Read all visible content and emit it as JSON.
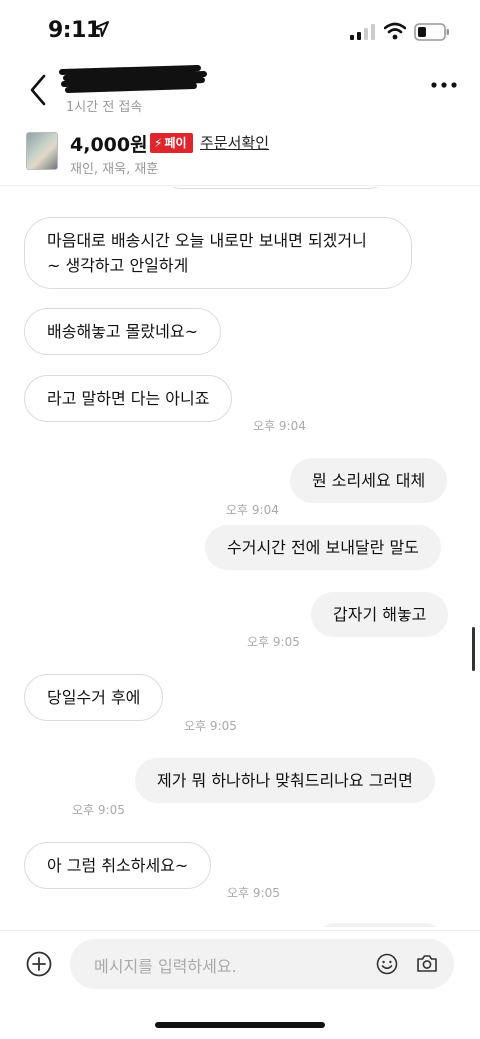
{
  "status_bar": {
    "time": "9:11"
  },
  "header": {
    "last_seen": "1시간 전 접속"
  },
  "product": {
    "price": "4,000원",
    "pay_badge": "페이",
    "order_link": "주문서확인",
    "tags": "재인, 재욱, 재훈"
  },
  "messages": [
    {
      "side": "in",
      "text": "마음대로 배송시간 오늘 내로만 보내면 되겠거니\n~ 생각하고 안일하게"
    },
    {
      "side": "in",
      "text": "배송해놓고 몰랐네요~"
    },
    {
      "side": "in",
      "text": "라고 말하면 다는 아니죠",
      "time": "오후 9:04"
    },
    {
      "side": "out",
      "text": "뭔 소리세요 대체",
      "time": "오후 9:04"
    },
    {
      "side": "out",
      "text": "수거시간 전에 보내달란 말도"
    },
    {
      "side": "out",
      "text": "갑자기 해놓고",
      "time": "오후 9:05"
    },
    {
      "side": "in",
      "text": "당일수거 후에",
      "time": "오후 9:05"
    },
    {
      "side": "out",
      "text": "제가 뭐 하나하나 맞춰드리나요 그러면",
      "time": "오후 9:05"
    },
    {
      "side": "in",
      "text": "아 그럼 취소하세요~",
      "time": "오후 9:05"
    }
  ],
  "input": {
    "placeholder": "메시지를 입력하세요."
  },
  "icons": {
    "back": "chevron-left-icon",
    "more": "more-icon",
    "add": "plus-circle-icon",
    "emoji": "smile-icon",
    "camera": "camera-icon"
  },
  "colors": {
    "pay_badge": "#e0262d",
    "outgoing_bubble": "#f2f2f2"
  }
}
